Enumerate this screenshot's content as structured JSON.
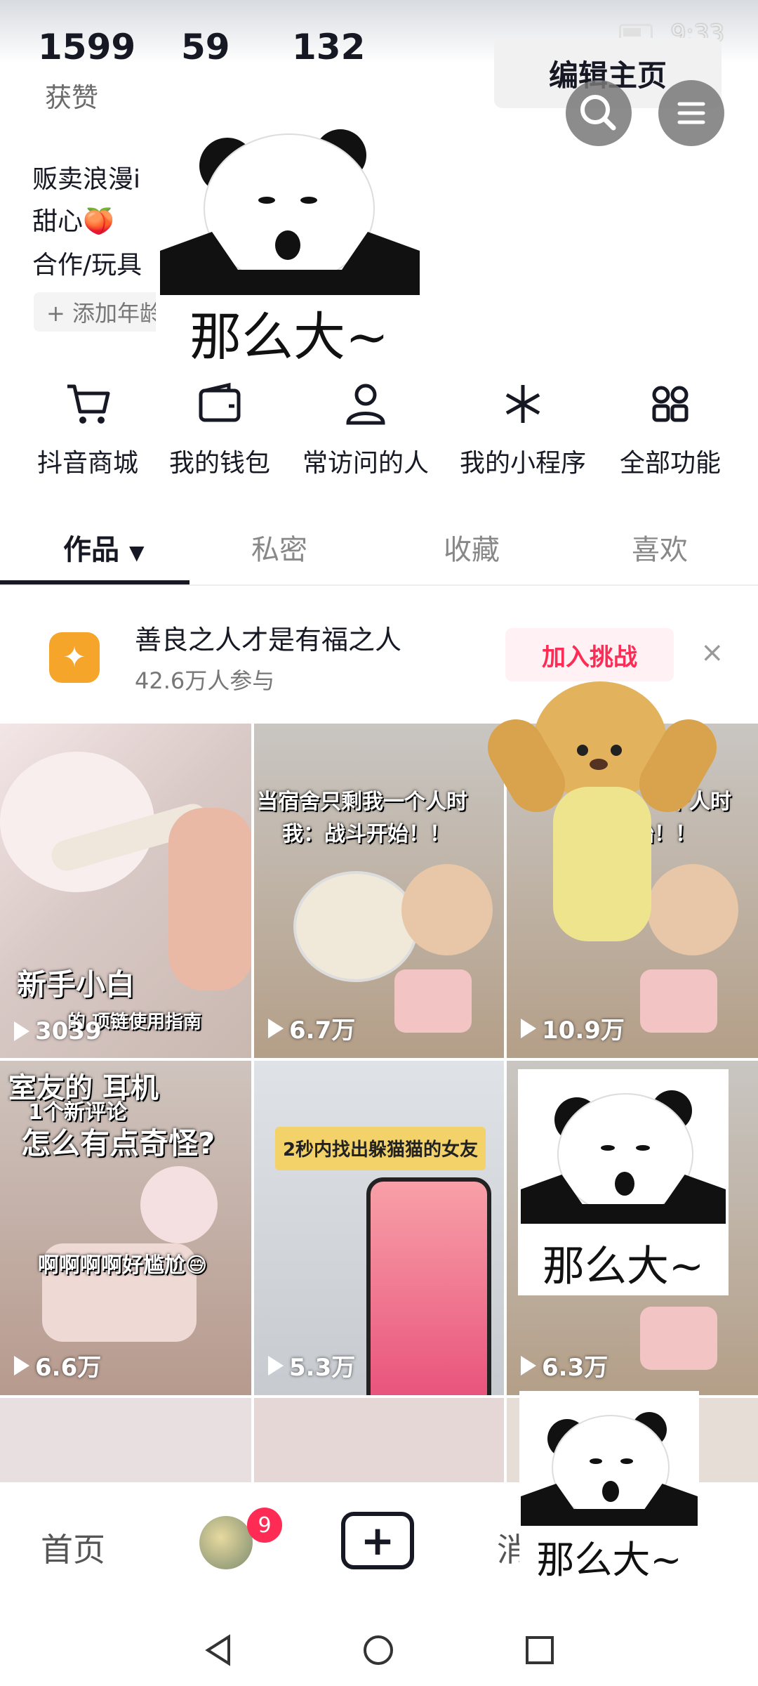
{
  "status": {
    "time": "9:33"
  },
  "profile": {
    "stats": [
      {
        "value": "1599",
        "label": "获赞"
      },
      {
        "value": "59",
        "label": ""
      },
      {
        "value": "132",
        "label": ""
      }
    ],
    "edit_label": "编辑主页",
    "bio_lines": [
      "贩卖浪漫i",
      "甜心🍑",
      "合作/玩具"
    ],
    "add_age_label": "+ 添加年龄"
  },
  "stickers": {
    "caption": "那么大~"
  },
  "shortcuts": [
    {
      "label": "抖音商城",
      "icon": "cart-icon"
    },
    {
      "label": "我的钱包",
      "icon": "wallet-icon"
    },
    {
      "label": "常访问的人",
      "icon": "person-icon"
    },
    {
      "label": "我的小程序",
      "icon": "asterisk-icon"
    },
    {
      "label": "全部功能",
      "icon": "grid-icon"
    }
  ],
  "tabs": [
    {
      "label": "作品"
    },
    {
      "label": "私密"
    },
    {
      "label": "收藏"
    },
    {
      "label": "喜欢"
    }
  ],
  "challenge": {
    "title": "善良之人才是有福之人",
    "subtitle": "42.6万人参与",
    "join_label": "加入挑战",
    "close": "×"
  },
  "videos": [
    {
      "count": "3039",
      "overlay_big": "新手小白",
      "overlay_small": "的 项链使用指南"
    },
    {
      "count": "6.7万",
      "overlay_top": "当宿舍只剩我一个人时",
      "overlay_sub": "我：战斗开始！！"
    },
    {
      "count": "10.9万",
      "overlay_top": "个人时",
      "overlay_sub": "始！！"
    },
    {
      "count": "6.6万",
      "overlay_top": "室友的 耳机",
      "overlay_new": "1个新评论",
      "overlay_big": "怎么有点奇怪?",
      "overlay_small": "啊啊啊啊好尴尬😅"
    },
    {
      "count": "5.3万",
      "overlay_label": "2秒内找出躲猫猫的女友"
    },
    {
      "count": "6.3万"
    }
  ],
  "bottom_nav": {
    "home": "首页",
    "badge": "9",
    "plus": "+",
    "message": "消"
  },
  "colors": {
    "accent": "#fe2c55",
    "challenge": "#f5a62a"
  }
}
